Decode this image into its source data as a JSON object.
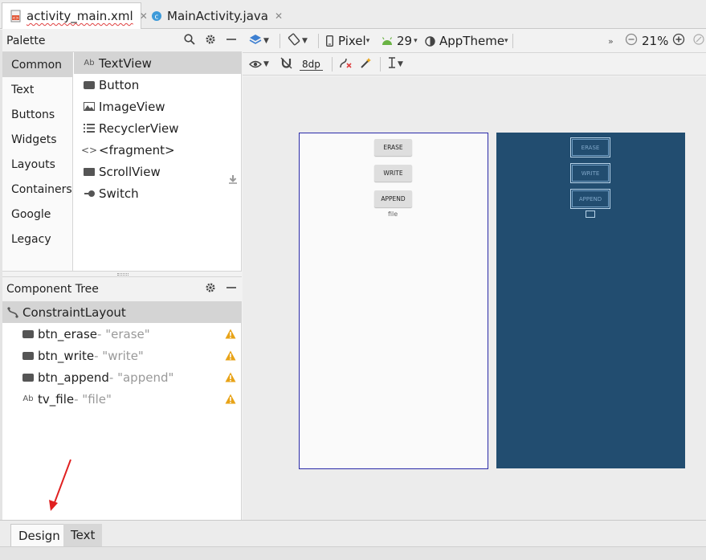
{
  "editor_tabs": [
    {
      "label": "activity_main.xml",
      "active": true,
      "icon": "xml-file-icon"
    },
    {
      "label": "MainActivity.java",
      "active": false,
      "icon": "java-class-icon"
    }
  ],
  "palette": {
    "title": "Palette",
    "categories": [
      "Common",
      "Text",
      "Buttons",
      "Widgets",
      "Layouts",
      "Containers",
      "Google",
      "Legacy"
    ],
    "selected_category": "Common",
    "widgets": [
      {
        "label": "TextView",
        "icon": "textview-icon"
      },
      {
        "label": "Button",
        "icon": "button-icon"
      },
      {
        "label": "ImageView",
        "icon": "image-icon"
      },
      {
        "label": "RecyclerView",
        "icon": "list-icon"
      },
      {
        "label": "<fragment>",
        "icon": "code-brackets-icon"
      },
      {
        "label": "ScrollView",
        "icon": "scrollview-icon"
      },
      {
        "label": "Switch",
        "icon": "switch-icon"
      }
    ]
  },
  "component_tree": {
    "title": "Component Tree",
    "root": "ConstraintLayout",
    "items": [
      {
        "id": "btn_erase",
        "sub": "- \"erase\"",
        "icon": "button-icon",
        "warning": true
      },
      {
        "id": "btn_write",
        "sub": "- \"write\"",
        "icon": "button-icon",
        "warning": true
      },
      {
        "id": "btn_append",
        "sub": "- \"append\"",
        "icon": "button-icon",
        "warning": true
      },
      {
        "id": "tv_file",
        "sub": "- \"file\"",
        "icon": "textview-icon",
        "warning": true
      }
    ]
  },
  "toolbar": {
    "device": "Pixel",
    "api": "29",
    "theme": "AppTheme",
    "zoom": "21%",
    "margin": "8dp"
  },
  "preview": {
    "buttons": [
      "ERASE",
      "WRITE",
      "APPEND"
    ],
    "textview": "file"
  },
  "blueprint": {
    "buttons": [
      "ERASE",
      "WRITE",
      "APPEND"
    ]
  },
  "bottom_tabs": [
    "Design",
    "Text"
  ],
  "colors": {
    "blueprint_bg": "#224d70",
    "warning": "#e8a317",
    "selection": "#d4d4d4",
    "annotation_arrow": "#e02020"
  }
}
